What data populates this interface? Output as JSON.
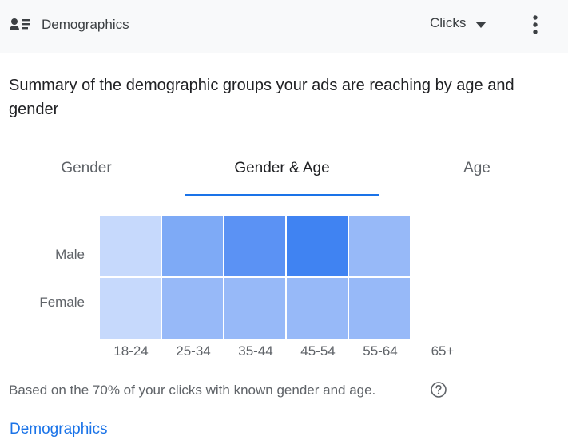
{
  "header": {
    "title": "Demographics",
    "title_icon": "person-list-icon",
    "metric_value": "Clicks",
    "more_icon": "more-vert-icon"
  },
  "summary_text": "Summary of the demographic groups your ads are reaching by age and gender",
  "tabs": [
    {
      "label": "Gender",
      "active": false
    },
    {
      "label": "Gender & Age",
      "active": true
    },
    {
      "label": "Age",
      "active": false
    }
  ],
  "heatmap": {
    "rows": [
      "Male",
      "Female"
    ],
    "columns": [
      "18-24",
      "25-34",
      "35-44",
      "45-54",
      "55-64",
      "65+"
    ],
    "cells": [
      [
        "#c6d9fc",
        "#7eaaf6",
        "#5b92f4",
        "#4083f2",
        "#97b9f8",
        null
      ],
      [
        "#c6d9fc",
        "#97b9f8",
        "#97b9f8",
        "#97b9f8",
        "#97b9f8",
        null
      ]
    ]
  },
  "footnote": "Based on the 70% of your clicks with known gender and age.",
  "help_icon": "help-circle-icon",
  "link_label": "Demographics",
  "colors": {
    "accent": "#1a73e8",
    "header_bg": "#f8f9fa"
  }
}
